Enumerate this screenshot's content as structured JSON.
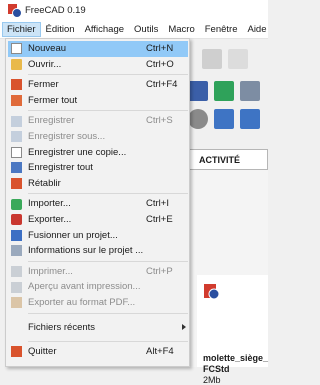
{
  "app": {
    "title": "FreeCAD 0.19"
  },
  "menubar": [
    "Fichier",
    "Édition",
    "Affichage",
    "Outils",
    "Macro",
    "Fenêtre",
    "Aide"
  ],
  "file_menu": [
    {
      "label": "Nouveau",
      "shortcut": "Ctrl+N",
      "icon": "new-document-icon",
      "disabled": false,
      "highlight": true
    },
    {
      "label": "Ouvrir...",
      "shortcut": "Ctrl+O",
      "icon": "open-folder-icon",
      "disabled": false
    },
    {
      "sep": true
    },
    {
      "label": "Fermer",
      "shortcut": "Ctrl+F4",
      "icon": "close-document-icon",
      "disabled": false
    },
    {
      "label": "Fermer tout",
      "shortcut": "",
      "icon": "close-all-icon",
      "disabled": false
    },
    {
      "sep": true
    },
    {
      "label": "Enregistrer",
      "shortcut": "Ctrl+S",
      "icon": "save-icon",
      "disabled": true
    },
    {
      "label": "Enregistrer sous...",
      "shortcut": "",
      "icon": "save-as-icon",
      "disabled": true
    },
    {
      "label": "Enregistrer une copie...",
      "shortcut": "",
      "icon": "save-copy-icon",
      "disabled": false
    },
    {
      "label": "Enregistrer tout",
      "shortcut": "",
      "icon": "save-all-icon",
      "disabled": false
    },
    {
      "label": "Rétablir",
      "shortcut": "",
      "icon": "revert-icon",
      "disabled": false
    },
    {
      "sep": true
    },
    {
      "label": "Importer...",
      "shortcut": "Ctrl+I",
      "icon": "import-icon",
      "disabled": false
    },
    {
      "label": "Exporter...",
      "shortcut": "Ctrl+E",
      "icon": "export-icon",
      "disabled": false
    },
    {
      "label": "Fusionner un projet...",
      "shortcut": "",
      "icon": "merge-project-icon",
      "disabled": false
    },
    {
      "label": "Informations sur le projet ...",
      "shortcut": "",
      "icon": "project-info-icon",
      "disabled": false
    },
    {
      "sep": true
    },
    {
      "label": "Imprimer...",
      "shortcut": "Ctrl+P",
      "icon": "print-icon",
      "disabled": true
    },
    {
      "label": "Aperçu avant impression...",
      "shortcut": "",
      "icon": "print-preview-icon",
      "disabled": true
    },
    {
      "label": "Exporter au format PDF...",
      "shortcut": "",
      "icon": "export-pdf-icon",
      "disabled": true
    },
    {
      "sep": true
    },
    {
      "label": "Fichiers récents",
      "shortcut": "",
      "icon": "",
      "disabled": false,
      "submenu": true
    },
    {
      "sep": true
    },
    {
      "label": "Quitter",
      "shortcut": "Alt+F4",
      "icon": "quit-icon",
      "disabled": false
    }
  ],
  "start_page": {
    "tab_label": "ACTIVITÉ",
    "file_name": "molette_siège_",
    "file_ext": "FCStd",
    "file_size": "2Mb"
  }
}
